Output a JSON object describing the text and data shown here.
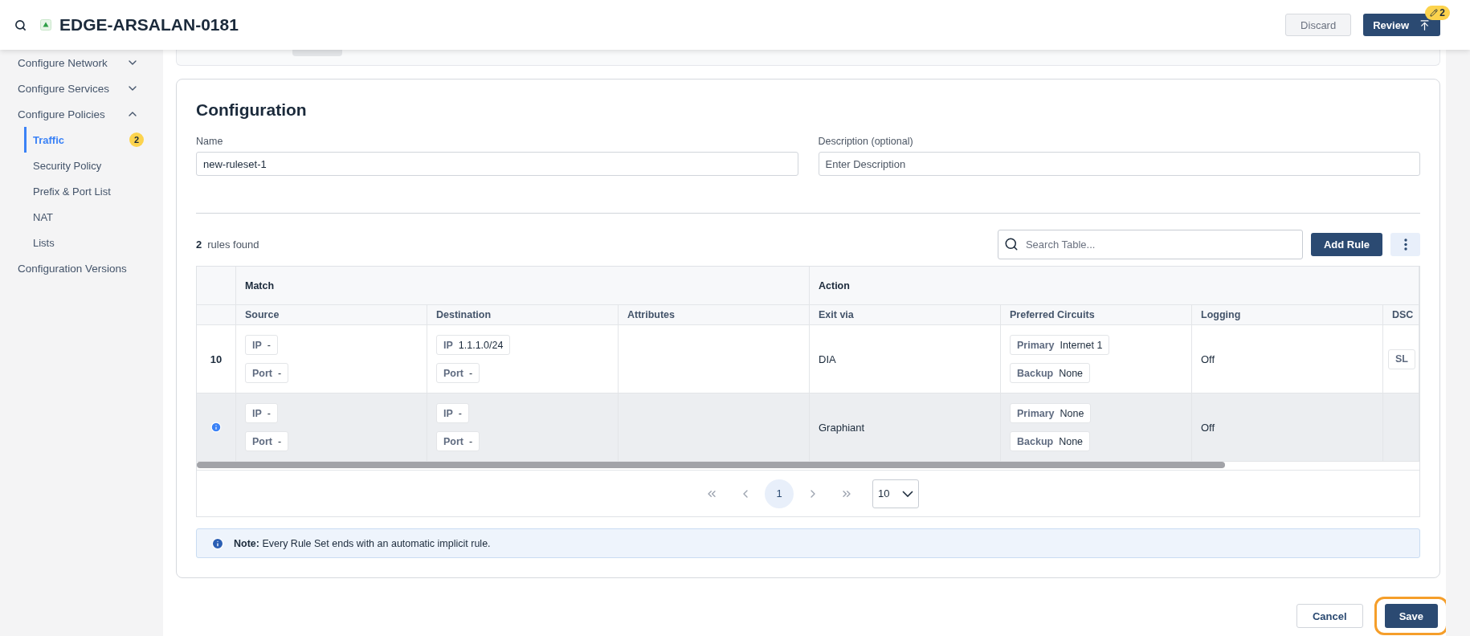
{
  "header": {
    "title": "EDGE-ARSALAN-0181",
    "discard_label": "Discard",
    "review_label": "Review",
    "review_badge": "2"
  },
  "sidebar": {
    "items": [
      {
        "label": "Configure Network",
        "expanded": false
      },
      {
        "label": "Configure Services",
        "expanded": false
      },
      {
        "label": "Configure Policies",
        "expanded": true,
        "children": [
          {
            "label": "Traffic",
            "selected": true,
            "badge": "2"
          },
          {
            "label": "Security Policy",
            "selected": false
          },
          {
            "label": "Prefix & Port List",
            "selected": false
          },
          {
            "label": "NAT",
            "selected": false
          },
          {
            "label": "Lists",
            "selected": false
          }
        ]
      },
      {
        "label": "Configuration Versions"
      }
    ]
  },
  "configuration": {
    "title": "Configuration",
    "name_field": {
      "label": "Name",
      "value": "new-ruleset-1"
    },
    "description_field": {
      "label": "Description (optional)",
      "placeholder": "Enter Description"
    },
    "rules_count": "2",
    "rules_found_label": "rules found",
    "search": {
      "placeholder": "Search Table..."
    },
    "add_rule_label": "Add Rule",
    "table": {
      "groups": [
        {
          "label": "Match"
        },
        {
          "label": "Action"
        }
      ],
      "columns": [
        "Source",
        "Destination",
        "Attributes",
        "Exit via",
        "Preferred Circuits",
        "Logging",
        "DSC"
      ],
      "rows": [
        {
          "marker": {
            "kind": "number",
            "text": "10"
          },
          "highlighted": false,
          "source": [
            {
              "label": "IP",
              "value": "-"
            },
            {
              "label": "Port",
              "value": "-"
            }
          ],
          "destination": [
            {
              "label": "IP",
              "value": "1.1.1.0/24"
            },
            {
              "label": "Port",
              "value": "-"
            }
          ],
          "exit_via": "DIA",
          "preferred_circuits": [
            {
              "label": "Primary",
              "value": "Internet 1"
            },
            {
              "label": "Backup",
              "value": "None"
            }
          ],
          "logging": "Off",
          "dscp_chip": "SL"
        },
        {
          "marker": {
            "kind": "info"
          },
          "highlighted": true,
          "source": [
            {
              "label": "IP",
              "value": "-"
            },
            {
              "label": "Port",
              "value": "-"
            }
          ],
          "destination": [
            {
              "label": "IP",
              "value": "-"
            },
            {
              "label": "Port",
              "value": "-"
            }
          ],
          "exit_via": "Graphiant",
          "preferred_circuits": [
            {
              "label": "Primary",
              "value": "None"
            },
            {
              "label": "Backup",
              "value": "None"
            }
          ],
          "logging": "Off"
        }
      ]
    },
    "pagination": {
      "pages": [
        {
          "label": "1",
          "selected": true
        }
      ],
      "page_size": "10"
    },
    "note": {
      "text": "**Note:** Every Rule Set ends with an automatic implicit rule."
    }
  },
  "footer": {
    "cancel_label": "Cancel",
    "save_label": "Save",
    "save_highlighted": true
  }
}
